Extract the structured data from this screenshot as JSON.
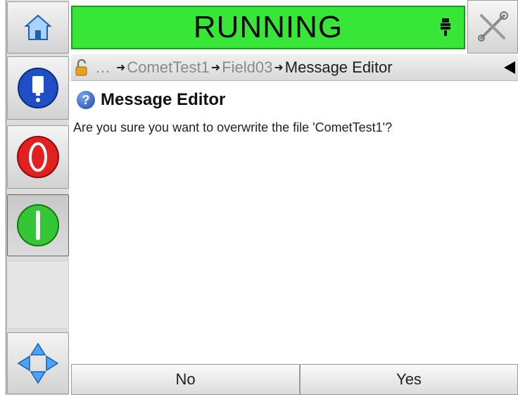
{
  "status": {
    "text": "RUNNING",
    "color": "#37e637"
  },
  "breadcrumb": {
    "lock_icon": "unlocked-padlock-icon",
    "ellipsis": "…",
    "items": [
      "CometTest1",
      "Field03",
      "Message Editor"
    ],
    "separator": "➜"
  },
  "dialog": {
    "title": "Message Editor",
    "question_icon": "?",
    "message": "Are you sure you want to overwrite the file 'CometTest1'?"
  },
  "buttons": {
    "no": "No",
    "yes": "Yes"
  },
  "side_buttons": [
    "home-icon",
    "ink-info-icon",
    "stop-icon",
    "start-icon",
    "navigate-icon"
  ]
}
